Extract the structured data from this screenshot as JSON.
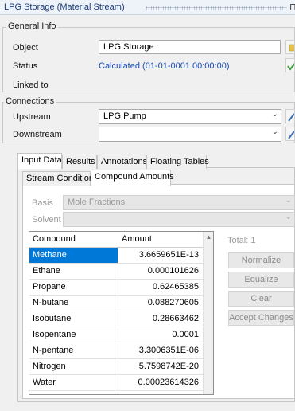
{
  "window": {
    "title": "LPG Storage (Material Stream)",
    "pin_glyph": "⊓"
  },
  "general_info": {
    "legend": "General Info",
    "object_label": "Object",
    "object_value": "LPG Storage",
    "status_label": "Status",
    "status_value": "Calculated (01-01-0001 00:00:00)",
    "linked_label": "Linked to"
  },
  "connections": {
    "legend": "Connections",
    "upstream_label": "Upstream",
    "upstream_value": "LPG Pump",
    "downstream_label": "Downstream",
    "downstream_value": ""
  },
  "main_tabs": [
    "Input Data",
    "Results",
    "Annotations",
    "Floating Tables"
  ],
  "sub_tabs": [
    "Stream Conditions",
    "Compound Amounts"
  ],
  "basis": {
    "label": "Basis",
    "value": "Mole Fractions"
  },
  "solvent": {
    "label": "Solvent",
    "value": ""
  },
  "grid": {
    "columns": [
      "Compound",
      "Amount"
    ],
    "rows": [
      {
        "compound": "Methane",
        "amount": "3.6659651E-13"
      },
      {
        "compound": "Ethane",
        "amount": "0.000101626"
      },
      {
        "compound": "Propane",
        "amount": "0.62465385"
      },
      {
        "compound": "N-butane",
        "amount": "0.088270605"
      },
      {
        "compound": "Isobutane",
        "amount": "0.28663462"
      },
      {
        "compound": "Isopentane",
        "amount": "0.0001"
      },
      {
        "compound": "N-pentane",
        "amount": "3.3006351E-06"
      },
      {
        "compound": "Nitrogen",
        "amount": "5.7598742E-20"
      },
      {
        "compound": "Water",
        "amount": "0.00023614326"
      }
    ]
  },
  "total": {
    "text": "Total: 1"
  },
  "actions": {
    "normalize": "Normalize",
    "equalize": "Equalize",
    "clear": "Clear",
    "accept": "Accept Changes"
  },
  "colors": {
    "selection": "#0078d7",
    "status_text": "#1a4db3",
    "title_text": "#1a3c78"
  }
}
